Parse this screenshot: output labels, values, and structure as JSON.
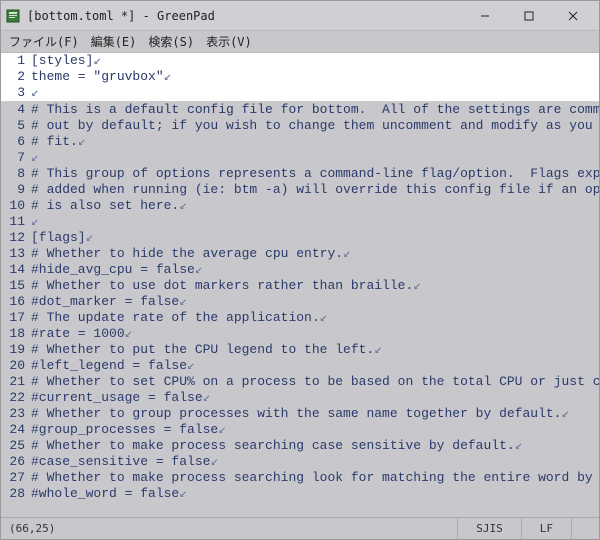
{
  "titlebar": {
    "title": "[bottom.toml *] - GreenPad"
  },
  "menubar": {
    "file": "ファイル(F)",
    "edit": "編集(E)",
    "search": "検索(S)",
    "view": "表示(V)"
  },
  "editor": {
    "eol_marker": "↙",
    "lines": [
      {
        "num": 1,
        "text": "[styles]"
      },
      {
        "num": 2,
        "text": "theme = \"gruvbox\""
      },
      {
        "num": 3,
        "text": ""
      },
      {
        "num": 4,
        "text": "# This is a default config file for bottom.  All of the settings are commente"
      },
      {
        "num": 5,
        "text": "# out by default; if you wish to change them uncomment and modify as you see"
      },
      {
        "num": 6,
        "text": "# fit."
      },
      {
        "num": 7,
        "text": ""
      },
      {
        "num": 8,
        "text": "# This group of options represents a command-line flag/option.  Flags explici"
      },
      {
        "num": 9,
        "text": "# added when running (ie: btm -a) will override this config file if an option"
      },
      {
        "num": 10,
        "text": "# is also set here."
      },
      {
        "num": 11,
        "text": ""
      },
      {
        "num": 12,
        "text": "[flags]"
      },
      {
        "num": 13,
        "text": "# Whether to hide the average cpu entry."
      },
      {
        "num": 14,
        "text": "#hide_avg_cpu = false"
      },
      {
        "num": 15,
        "text": "# Whether to use dot markers rather than braille."
      },
      {
        "num": 16,
        "text": "#dot_marker = false"
      },
      {
        "num": 17,
        "text": "# The update rate of the application."
      },
      {
        "num": 18,
        "text": "#rate = 1000"
      },
      {
        "num": 19,
        "text": "# Whether to put the CPU legend to the left."
      },
      {
        "num": 20,
        "text": "#left_legend = false"
      },
      {
        "num": 21,
        "text": "# Whether to set CPU% on a process to be based on the total CPU or just curre"
      },
      {
        "num": 22,
        "text": "#current_usage = false"
      },
      {
        "num": 23,
        "text": "# Whether to group processes with the same name together by default."
      },
      {
        "num": 24,
        "text": "#group_processes = false"
      },
      {
        "num": 25,
        "text": "# Whether to make process searching case sensitive by default."
      },
      {
        "num": 26,
        "text": "#case_sensitive = false"
      },
      {
        "num": 27,
        "text": "# Whether to make process searching look for matching the entire word by defa"
      },
      {
        "num": 28,
        "text": "#whole_word = false"
      }
    ]
  },
  "statusbar": {
    "cursor": "(66,25)",
    "encoding": "SJIS",
    "line_ending": "LF"
  }
}
